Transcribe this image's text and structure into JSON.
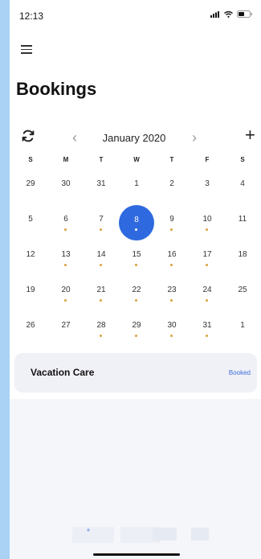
{
  "status_bar": {
    "time": "12:13"
  },
  "page": {
    "title": "Bookings"
  },
  "calendar": {
    "month_label": "January 2020",
    "weekdays": [
      "S",
      "M",
      "T",
      "W",
      "T",
      "F",
      "S"
    ],
    "selected_day": 8,
    "accent_color": "#2e69df",
    "dot_color": "#d8a23c",
    "weeks": [
      [
        {
          "d": "29",
          "dot": false
        },
        {
          "d": "30",
          "dot": false
        },
        {
          "d": "31",
          "dot": false
        },
        {
          "d": "1",
          "dot": false
        },
        {
          "d": "2",
          "dot": false
        },
        {
          "d": "3",
          "dot": false
        },
        {
          "d": "4",
          "dot": false
        }
      ],
      [
        {
          "d": "5",
          "dot": false
        },
        {
          "d": "6",
          "dot": true
        },
        {
          "d": "7",
          "dot": true
        },
        {
          "d": "8",
          "dot": true
        },
        {
          "d": "9",
          "dot": true
        },
        {
          "d": "10",
          "dot": true
        },
        {
          "d": "11",
          "dot": false
        }
      ],
      [
        {
          "d": "12",
          "dot": false
        },
        {
          "d": "13",
          "dot": true
        },
        {
          "d": "14",
          "dot": true
        },
        {
          "d": "15",
          "dot": true
        },
        {
          "d": "16",
          "dot": true
        },
        {
          "d": "17",
          "dot": true
        },
        {
          "d": "18",
          "dot": false
        }
      ],
      [
        {
          "d": "19",
          "dot": false
        },
        {
          "d": "20",
          "dot": true
        },
        {
          "d": "21",
          "dot": true
        },
        {
          "d": "22",
          "dot": true
        },
        {
          "d": "23",
          "dot": true
        },
        {
          "d": "24",
          "dot": true
        },
        {
          "d": "25",
          "dot": false
        }
      ],
      [
        {
          "d": "26",
          "dot": false
        },
        {
          "d": "27",
          "dot": false
        },
        {
          "d": "28",
          "dot": true
        },
        {
          "d": "29",
          "dot": true
        },
        {
          "d": "30",
          "dot": true
        },
        {
          "d": "31",
          "dot": true
        },
        {
          "d": "1",
          "dot": false
        }
      ]
    ]
  },
  "booking": {
    "title": "Vacation Care",
    "status": "Booked",
    "status_color": "#3a70d8"
  }
}
